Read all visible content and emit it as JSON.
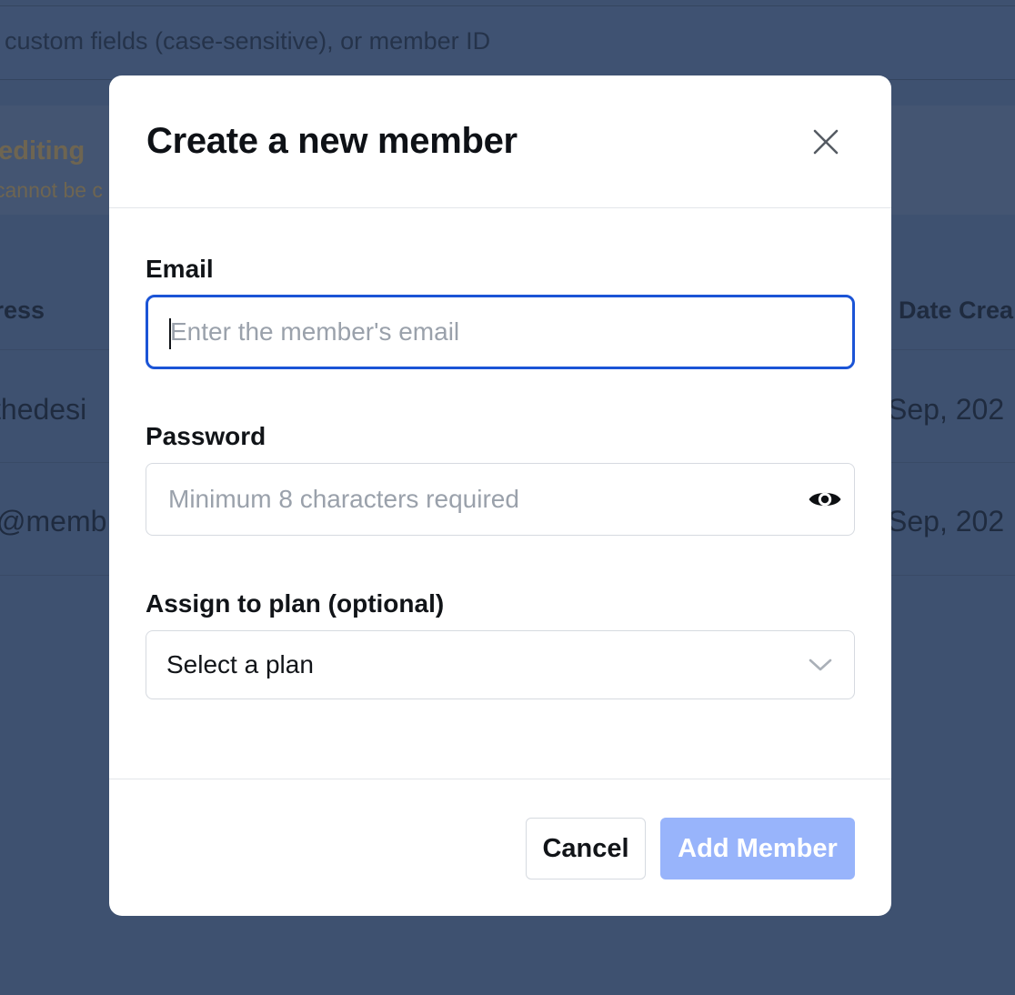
{
  "background": {
    "search_placeholder": "il, custom fields (case-sensitive), or member ID",
    "notice_title": "l editing",
    "notice_subtitle": "cannot be c",
    "columns": {
      "address": "lress",
      "date_created": "Date Crea"
    },
    "rows": [
      {
        "email": "thedesi",
        "date": "Sep, 202"
      },
      {
        "email": "@memb",
        "date": "Sep, 202"
      }
    ]
  },
  "modal": {
    "title": "Create a new member",
    "close_icon": "close-icon",
    "email": {
      "label": "Email",
      "placeholder": "Enter the member's email",
      "value": ""
    },
    "password": {
      "label": "Password",
      "placeholder": "Minimum 8 characters required",
      "value": "",
      "toggle_icon": "eye-icon"
    },
    "plan": {
      "label": "Assign to plan (optional)",
      "selected": "Select a plan",
      "icon": "chevron-down-icon"
    },
    "buttons": {
      "cancel": "Cancel",
      "add": "Add Member"
    }
  },
  "colors": {
    "overlay": "#3e5170",
    "focus_ring": "#1b54d6",
    "primary_disabled": "#98b4fb"
  }
}
